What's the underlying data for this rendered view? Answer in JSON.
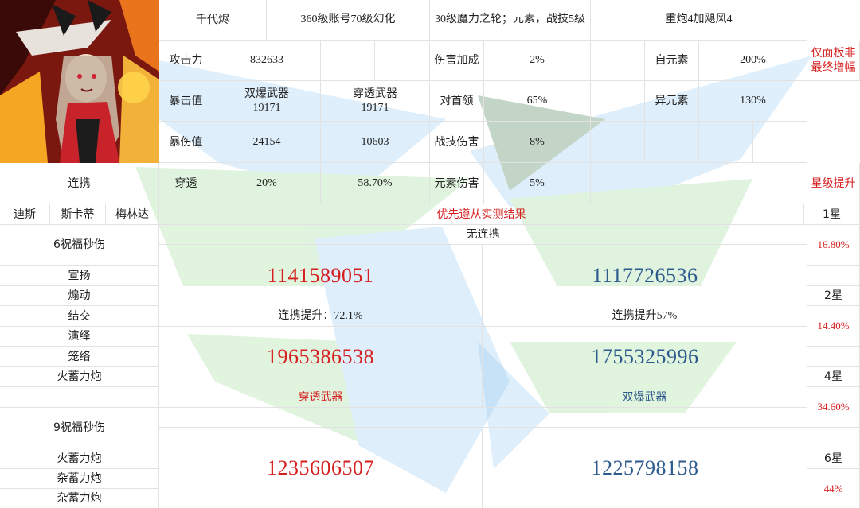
{
  "header": {
    "name": "千代烬",
    "account": "360级账号70级幻化",
    "wheel": "30级魔力之轮；元素，战技5级",
    "set": "重炮4加飓风4",
    "note": "仅面板非最终增幅"
  },
  "stats": {
    "atk_label": "攻击力",
    "atk_value": "832633",
    "crit_label": "暴击值",
    "crit_weapon_a": "双爆武器",
    "crit_value_a": "19171",
    "crit_weapon_b": "穿透武器",
    "crit_value_b": "19171",
    "critdmg_label": "暴伤值",
    "critdmg_a": "24154",
    "critdmg_b": "10603",
    "pen_label": "穿透",
    "pen_a": "20%",
    "pen_b": "58.70%",
    "dmg_bonus_label": "伤害加成",
    "dmg_bonus": "2%",
    "boss_label": "对首领",
    "boss": "65%",
    "skill_label": "战技伤害",
    "skill": "8%",
    "elem_dmg_label": "元素伤害",
    "elem_dmg": "5%",
    "self_elem_label": "自元素",
    "self_elem": "200%",
    "diff_elem_label": "异元素",
    "diff_elem": "130%"
  },
  "combo": {
    "label": "连携",
    "members": [
      "迪斯",
      "斯卡蒂",
      "梅林达"
    ],
    "priority_note": "优先遵从实测结果",
    "star_title": "星级提升"
  },
  "sections": {
    "six_title": "6祝福秒伤",
    "six_items": [
      "宣扬",
      "煽动",
      "结交",
      "演绎",
      "笼络",
      "火蓄力炮"
    ],
    "nine_title": "9祝福秒伤",
    "nine_items": [
      "火蓄力炮",
      "杂蓄力炮",
      "杂蓄力炮"
    ]
  },
  "results": {
    "no_combo": "无连携",
    "pen_no_combo": "1141589051",
    "crit_no_combo": "1117726536",
    "pen_combo_gain": "连携提升：72.1%",
    "crit_combo_gain": "连携提升57%",
    "pen_combo": "1965386538",
    "crit_combo": "1755325996",
    "pen_weapon": "穿透武器",
    "crit_weapon": "双爆武器",
    "pen_nine": "1235606507",
    "crit_nine": "1225798158"
  },
  "stars": [
    {
      "label": "1星",
      "value": "16.80%"
    },
    {
      "label": "2星",
      "value": "14.40%"
    },
    {
      "label": "4星",
      "value": "34.60%"
    },
    {
      "label": "6星",
      "value": "44%"
    }
  ],
  "colors": {
    "red": "#d61f1f",
    "blue": "#2c5a8c",
    "watermark_green": "#8fd68a",
    "watermark_blue": "#8cc6ef"
  }
}
